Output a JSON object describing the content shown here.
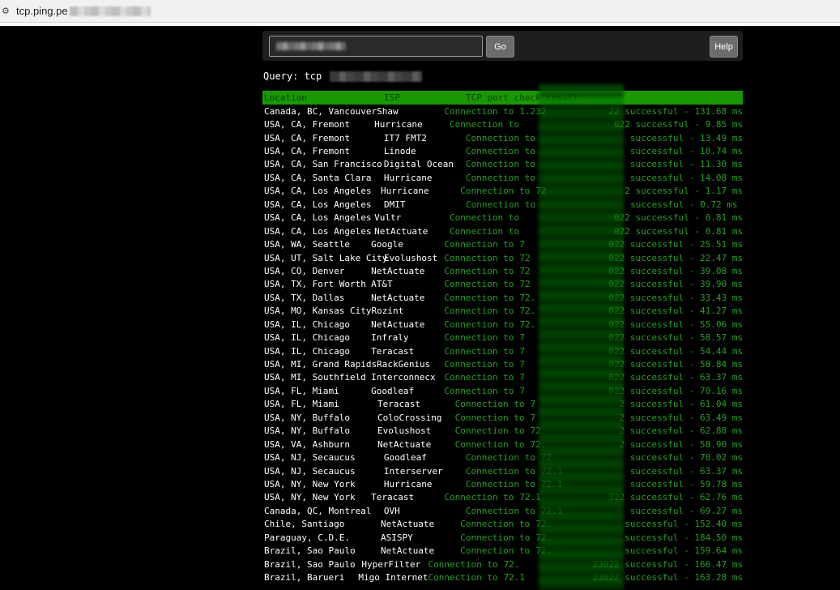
{
  "browser": {
    "url_visible": "tcp.ping.pe"
  },
  "search": {
    "go_label": "Go",
    "help_label": "Help"
  },
  "query": {
    "label": "Query: tcp"
  },
  "table": {
    "headers": [
      "Location",
      "ISP",
      "TCP port check result"
    ],
    "rows": [
      {
        "location": "Canada, BC, Vancouver",
        "isp": "Shaw",
        "result_prefix": "Connection to",
        "ip": "1.232",
        "result_suffix": "22 successful - 131.68 ms"
      },
      {
        "location": "USA, CA, Fremont",
        "isp": "Hurricane",
        "result_prefix": "Connection to",
        "ip": "",
        "result_suffix": "022 successful - 9.85 ms"
      },
      {
        "location": "USA, CA, Fremont",
        "isp": "IT7 FMT2",
        "result_prefix": "Connection to",
        "ip": "",
        "result_suffix": "successful - 13.49 ms"
      },
      {
        "location": "USA, CA, Fremont",
        "isp": "Linode",
        "result_prefix": "Connection to",
        "ip": "",
        "result_suffix": "successful - 10.74 ms"
      },
      {
        "location": "USA, CA, San Francisco",
        "isp": "Digital Ocean",
        "result_prefix": "Connection to",
        "ip": "",
        "result_suffix": "successful - 11.30 ms"
      },
      {
        "location": "USA, CA, Santa Clara",
        "isp": "Hurricane",
        "result_prefix": "Connection to",
        "ip": "",
        "result_suffix": "successful - 14.08 ms"
      },
      {
        "location": "USA, CA, Los Angeles",
        "isp": "Hurricane",
        "result_prefix": "Connection to",
        "ip": "72",
        "result_suffix": "2 successful - 1.17 ms"
      },
      {
        "location": "USA, CA, Los Angeles",
        "isp": "DMIT",
        "result_prefix": "Connection to",
        "ip": "",
        "result_suffix": "successful - 0.72 ms"
      },
      {
        "location": "USA, CA, Los Angeles",
        "isp": "Vultr",
        "result_prefix": "Connection to",
        "ip": "",
        "result_suffix": "022 successful - 0.81 ms"
      },
      {
        "location": "USA, CA, Los Angeles",
        "isp": "NetActuate",
        "result_prefix": "Connection to",
        "ip": "",
        "result_suffix": "022 successful - 0.81 ms"
      },
      {
        "location": "USA, WA, Seattle",
        "isp": "Google",
        "result_prefix": "Connection to",
        "ip": "7",
        "result_suffix": "022 successful - 25.51 ms"
      },
      {
        "location": "USA, UT, Salt Lake City",
        "isp": "Evolushost",
        "result_prefix": "Connection to",
        "ip": "72",
        "result_suffix": "022 successful - 22.47 ms"
      },
      {
        "location": "USA, CO, Denver",
        "isp": "NetActuate",
        "result_prefix": "Connection to",
        "ip": "72",
        "result_suffix": "022 successful - 39.08 ms"
      },
      {
        "location": "USA, TX, Fort Worth",
        "isp": "AT&T",
        "result_prefix": "Connection to",
        "ip": "72",
        "result_suffix": "022 successful - 39.90 ms"
      },
      {
        "location": "USA, TX, Dallas",
        "isp": "NetActuate",
        "result_prefix": "Connection to",
        "ip": "72.",
        "result_suffix": "022 successful - 33.43 ms"
      },
      {
        "location": "USA, MO, Kansas City",
        "isp": "Rozint",
        "result_prefix": "Connection to",
        "ip": "72.",
        "result_suffix": "022 successful - 41.27 ms"
      },
      {
        "location": "USA, IL, Chicago",
        "isp": "NetActuate",
        "result_prefix": "Connection to",
        "ip": "72.",
        "result_suffix": "022 successful - 55.06 ms"
      },
      {
        "location": "USA, IL, Chicago",
        "isp": "Infraly",
        "result_prefix": "Connection to",
        "ip": "7",
        "result_suffix": "022 successful - 58.57 ms"
      },
      {
        "location": "USA, IL, Chicago",
        "isp": "Teracast",
        "result_prefix": "Connection to",
        "ip": "7",
        "result_suffix": "022 successful - 54.44 ms"
      },
      {
        "location": "USA, MI, Grand Rapids",
        "isp": "RackGenius",
        "result_prefix": "Connection to",
        "ip": "7",
        "result_suffix": "022 successful - 58.84 ms"
      },
      {
        "location": "USA, MI, Southfield",
        "isp": "Interconnecx",
        "result_prefix": "Connection to",
        "ip": "7",
        "result_suffix": "022 successful - 63.37 ms"
      },
      {
        "location": "USA, FL, Miami",
        "isp": "Goodleaf",
        "result_prefix": "Connection to",
        "ip": "7",
        "result_suffix": "022 successful - 70.16 ms"
      },
      {
        "location": "USA, FL, Miami",
        "isp": "Teracast",
        "result_prefix": "Connection to",
        "ip": "7",
        "result_suffix": "2 successful - 61.04 ms"
      },
      {
        "location": "USA, NY, Buffalo",
        "isp": "ColoCrossing",
        "result_prefix": "Connection to",
        "ip": "7",
        "result_suffix": "2 successful - 63.49 ms"
      },
      {
        "location": "USA, NY, Buffalo",
        "isp": "Evolushost",
        "result_prefix": "Connection to",
        "ip": "72",
        "result_suffix": "2 successful - 62.88 ms"
      },
      {
        "location": "USA, VA, Ashburn",
        "isp": "NetActuate",
        "result_prefix": "Connection to",
        "ip": "72.",
        "result_suffix": "2 successful - 58.90 ms"
      },
      {
        "location": "USA, NJ, Secaucus",
        "isp": "Goodleaf",
        "result_prefix": "Connection to",
        "ip": "72.",
        "result_suffix": "successful - 70.02 ms"
      },
      {
        "location": "USA, NJ, Secaucus",
        "isp": "Interserver",
        "result_prefix": "Connection to",
        "ip": "72.1",
        "result_suffix": "successful - 63.37 ms"
      },
      {
        "location": "USA, NY, New York",
        "isp": "Hurricane",
        "result_prefix": "Connection to",
        "ip": "72.1",
        "result_suffix": "successful - 59.78 ms"
      },
      {
        "location": "USA, NY, New York",
        "isp": "Teracast",
        "result_prefix": "Connection to",
        "ip": "72.1",
        "result_suffix": "322 successful - 62.76 ms"
      },
      {
        "location": "Canada, QC, Montreal",
        "isp": "OVH",
        "result_prefix": "Connection to",
        "ip": "72.1",
        "result_suffix": "successful - 69.27 ms"
      },
      {
        "location": "Chile, Santiago",
        "isp": "NetActuate",
        "result_prefix": "Connection to",
        "ip": "72.",
        "result_suffix": "successful - 152.40 ms"
      },
      {
        "location": "Paraguay, C.D.E.",
        "isp": "ASISPY",
        "result_prefix": "Connection to",
        "ip": "72.",
        "result_suffix": "successful - 184.50 ms"
      },
      {
        "location": "Brazil, Sao Paulo",
        "isp": "NetActuate",
        "result_prefix": "Connection to",
        "ip": "72.",
        "result_suffix": "successful - 159.64 ms"
      },
      {
        "location": "Brazil, Sao Paulo",
        "isp": "HyperFilter",
        "result_prefix": "Connection to",
        "ip": "72.",
        "result_suffix": "23022 successful - 166.47 ms"
      },
      {
        "location": "Brazil, Barueri",
        "isp": "Migo Internet",
        "result_prefix": "Connection to",
        "ip": "72.1",
        "result_suffix": "23022 successful - 163.28 ms"
      }
    ]
  }
}
